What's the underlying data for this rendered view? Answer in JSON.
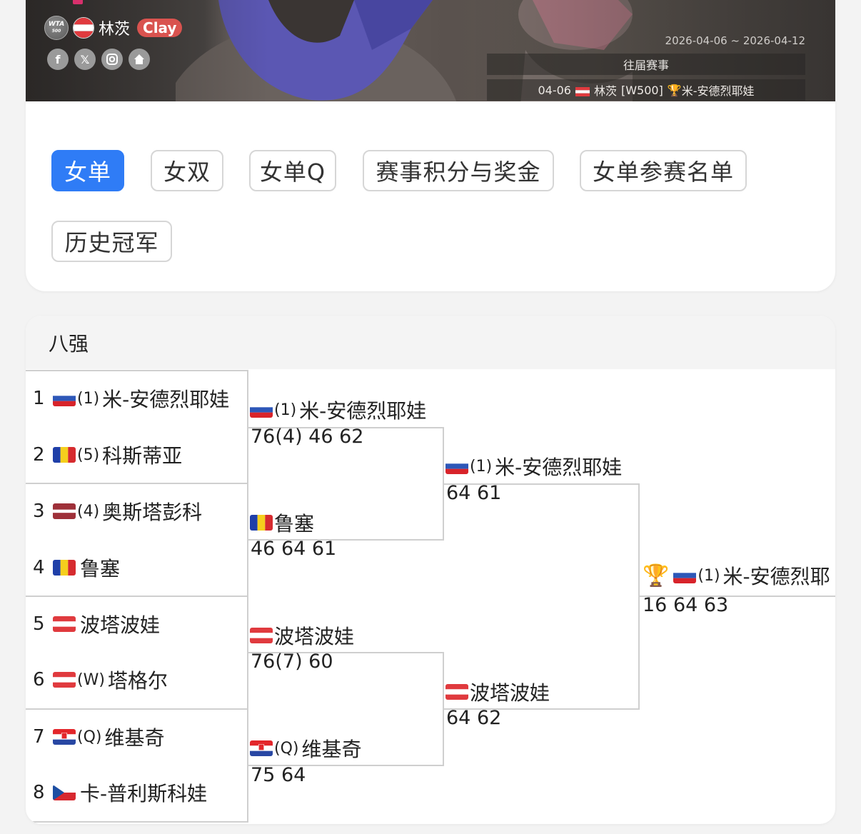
{
  "banner": {
    "tour_badge": "WTA",
    "tour_badge_sub": "500",
    "city": "林茨",
    "surface": "Clay",
    "social_icons": [
      "facebook-icon",
      "x-icon",
      "instagram-icon",
      "home-icon"
    ],
    "date_range": "2026-04-06 ~ 2026-04-12",
    "past_title": "往届赛事",
    "past_entry": {
      "date": "04-06",
      "city": "林茨",
      "level": "[W500]",
      "winner": "米-安德烈耶娃"
    }
  },
  "tabs": [
    {
      "label": "女单",
      "active": true
    },
    {
      "label": "女双",
      "active": false
    },
    {
      "label": "女单Q",
      "active": false
    },
    {
      "label": "赛事积分与奖金",
      "active": false
    },
    {
      "label": "女单参赛名单",
      "active": false
    },
    {
      "label": "历史冠军",
      "active": false
    }
  ],
  "bracket": {
    "round_title": "八强",
    "players": [
      {
        "num": "1",
        "flag": "rus",
        "seed": "(1)",
        "name": "米-安德烈耶娃"
      },
      {
        "num": "2",
        "flag": "rou",
        "seed": "(5)",
        "name": "科斯蒂亚"
      },
      {
        "num": "3",
        "flag": "lat",
        "seed": "(4)",
        "name": "奥斯塔彭科"
      },
      {
        "num": "4",
        "flag": "rou",
        "seed": "",
        "name": "鲁塞"
      },
      {
        "num": "5",
        "flag": "aut",
        "seed": "",
        "name": "波塔波娃"
      },
      {
        "num": "6",
        "flag": "aut",
        "seed": "(W)",
        "name": "塔格尔"
      },
      {
        "num": "7",
        "flag": "cro",
        "seed": "(Q)",
        "name": "维基奇"
      },
      {
        "num": "8",
        "flag": "cze",
        "seed": "",
        "name": "卡-普利斯科娃"
      }
    ],
    "semifinalists": [
      {
        "flag": "rus",
        "seed": "(1)",
        "name": "米-安德烈耶娃",
        "score": "76(4) 46 62"
      },
      {
        "flag": "rou",
        "seed": "",
        "name": "鲁塞",
        "score": "46 64 61"
      },
      {
        "flag": "aut",
        "seed": "",
        "name": "波塔波娃",
        "score": "76(7) 60"
      },
      {
        "flag": "cro",
        "seed": "(Q)",
        "name": "维基奇",
        "score": "75 64"
      }
    ],
    "finalists": [
      {
        "flag": "rus",
        "seed": "(1)",
        "name": "米-安德烈耶娃",
        "score": "64 61"
      },
      {
        "flag": "aut",
        "seed": "",
        "name": "波塔波娃",
        "score": "64 62"
      }
    ],
    "champion": {
      "flag": "rus",
      "seed": "(1)",
      "name": "米-安德烈耶",
      "score": "16 64 63"
    }
  }
}
